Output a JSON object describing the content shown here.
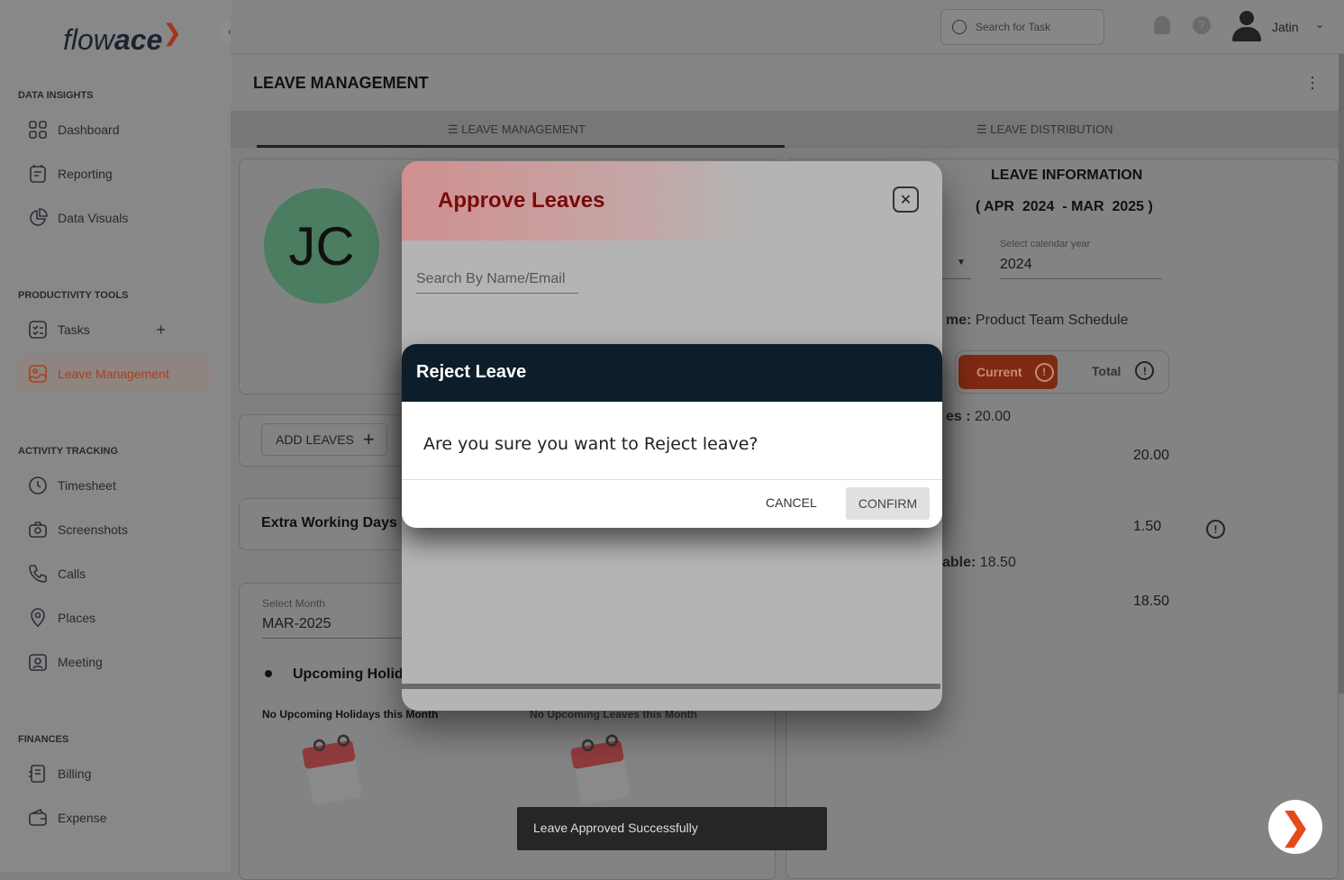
{
  "app": {
    "logo_light": "flow",
    "logo_bold": "ace",
    "user": "Jatin",
    "search_placeholder": "Search for Task"
  },
  "sidebar": {
    "sections": [
      {
        "title": "DATA INSIGHTS",
        "items": [
          {
            "label": "Dashboard",
            "icon": "grid-icon"
          },
          {
            "label": "Reporting",
            "icon": "report-icon"
          },
          {
            "label": "Data Visuals",
            "icon": "pie-icon"
          }
        ]
      },
      {
        "title": "PRODUCTIVITY TOOLS",
        "items": [
          {
            "label": "Tasks",
            "icon": "tasks-icon"
          },
          {
            "label": "Leave Management",
            "icon": "image-icon",
            "active": true
          }
        ]
      },
      {
        "title": "ACTIVITY TRACKING",
        "items": [
          {
            "label": "Timesheet",
            "icon": "clock-icon"
          },
          {
            "label": "Screenshots",
            "icon": "camera-icon"
          },
          {
            "label": "Calls",
            "icon": "phone-icon"
          },
          {
            "label": "Places",
            "icon": "pin-icon"
          },
          {
            "label": "Meeting",
            "icon": "meeting-icon"
          }
        ]
      },
      {
        "title": "FINANCES",
        "items": [
          {
            "label": "Billing",
            "icon": "billing-icon"
          },
          {
            "label": "Expense",
            "icon": "wallet-icon"
          }
        ]
      }
    ]
  },
  "page": {
    "title": "LEAVE MANAGEMENT",
    "tabs": [
      "LEAVE MANAGEMENT",
      "LEAVE DISTRIBUTION"
    ],
    "active_tab": 0
  },
  "left": {
    "avatar_initials": "JC",
    "add_leaves": "ADD LEAVES",
    "extra_working_days": "Extra Working Days :",
    "select_month_label": "Select Month",
    "select_month_value": "MAR-2025",
    "upcoming_holidays": "Upcoming Holida",
    "no_holidays": "No Upcoming Holidays this Month",
    "no_leaves": "No Upcoming Leaves this Month"
  },
  "info": {
    "title": "LEAVE INFORMATION",
    "period": "( APR  2024  - MAR  2025 )",
    "year_label": "Select calendar year",
    "year_value": "2024",
    "schedule_label": "me:",
    "schedule_value": "Product Team Schedule",
    "seg_current": "Current",
    "seg_total": "Total",
    "leaves_label": "es :",
    "leaves_value": "20.00",
    "row1": "20.00",
    "row2": "1.50",
    "available_label": "able:",
    "available_value": "18.50",
    "row3": "18.50"
  },
  "approve_modal": {
    "title": "Approve Leaves",
    "search_placeholder": "Search By Name/Email"
  },
  "reject_dialog": {
    "title": "Reject Leave",
    "message": "Are you sure you want to Reject leave?",
    "cancel": "CANCEL",
    "confirm": "CONFIRM"
  },
  "toast": {
    "message": "Leave Approved Successfully"
  },
  "colors": {
    "accent": "#e5541f",
    "dialog_header": "#0d1e2a",
    "approve_title": "#7a0a0a"
  }
}
